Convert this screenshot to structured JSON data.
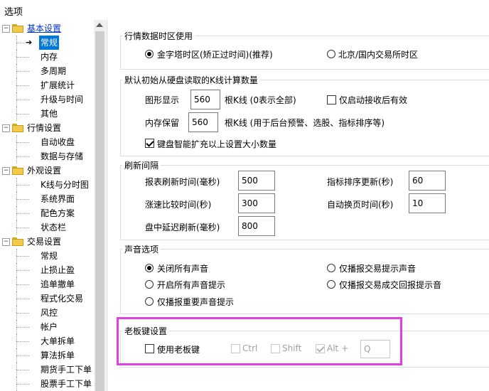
{
  "window": {
    "title": "选项"
  },
  "tree": {
    "items": [
      {
        "label": "基本设置",
        "level": 0,
        "expanded": true,
        "link": true
      },
      {
        "label": "常规",
        "level": 1,
        "selected": true
      },
      {
        "label": "内存",
        "level": 1
      },
      {
        "label": "多周期",
        "level": 1
      },
      {
        "label": "扩展统计",
        "level": 1
      },
      {
        "label": "升级与时间",
        "level": 1
      },
      {
        "label": "其他",
        "level": 1
      },
      {
        "label": "行情设置",
        "level": 0,
        "expanded": true
      },
      {
        "label": "自动收盘",
        "level": 1
      },
      {
        "label": "数据与存储",
        "level": 1
      },
      {
        "label": "外观设置",
        "level": 0,
        "expanded": true
      },
      {
        "label": "K线与分时图",
        "level": 1
      },
      {
        "label": "系统界面",
        "level": 1
      },
      {
        "label": "配色方案",
        "level": 1
      },
      {
        "label": "状态栏",
        "level": 1
      },
      {
        "label": "交易设置",
        "level": 0,
        "expanded": true
      },
      {
        "label": "常规",
        "level": 1
      },
      {
        "label": "止损止盈",
        "level": 1
      },
      {
        "label": "追单撤单",
        "level": 1
      },
      {
        "label": "程式化交易",
        "level": 1
      },
      {
        "label": "风控",
        "level": 1
      },
      {
        "label": "帐户",
        "level": 1
      },
      {
        "label": "大单拆单",
        "level": 1
      },
      {
        "label": "算法拆单",
        "level": 1
      },
      {
        "label": "期货手工下单",
        "level": 1
      },
      {
        "label": "股票手工下单",
        "level": 1
      }
    ]
  },
  "timezone": {
    "title": "行情数据时区使用",
    "opt_gmt": "金字塔时区(矫正过时间)(推荐)",
    "opt_beijing": "北京/国内交易所时区",
    "selected": "gmt"
  },
  "kline": {
    "title": "默认初始从硬盘读取的K线计算数量",
    "graph_label": "图形显示",
    "graph_value": "560",
    "graph_suffix": "根K线 (0表示全部)",
    "startup_only": "仅启动接收后有效",
    "mem_label": "内存保留",
    "mem_value": "560",
    "mem_suffix": "根K线  (用于后台预警、选股、指标排序等)",
    "smart_expand": "键盘智能扩充以上设置大小数量",
    "smart_expand_checked": true
  },
  "refresh": {
    "title": "刷新间隔",
    "report_label": "报表刷新时间(毫秒)",
    "report_value": "500",
    "sort_label": "指标排序更新(秒)",
    "sort_value": "60",
    "speed_label": "涨速比较时间(秒)",
    "speed_value": "300",
    "page_label": "自动换页时间(秒)",
    "page_value": "10",
    "delay_label": "盘中延迟刷新(毫秒)",
    "delay_value": "800"
  },
  "sound": {
    "title": "声音选项",
    "opt_off": "关闭所有声音",
    "opt_trade": "仅播报交易提示声音",
    "opt_all": "开启所有声音提示",
    "opt_trade_fill": "仅播报交易成交回报提示音",
    "opt_important": "仅播报重要声音提示",
    "selected": "off"
  },
  "boss": {
    "title": "老板键设置",
    "use_label": "使用老板键",
    "ctrl": "Ctrl",
    "shift": "Shift",
    "alt": "Alt +",
    "key": "Q",
    "alt_checked": true,
    "highlight_color": "#e040e0"
  }
}
